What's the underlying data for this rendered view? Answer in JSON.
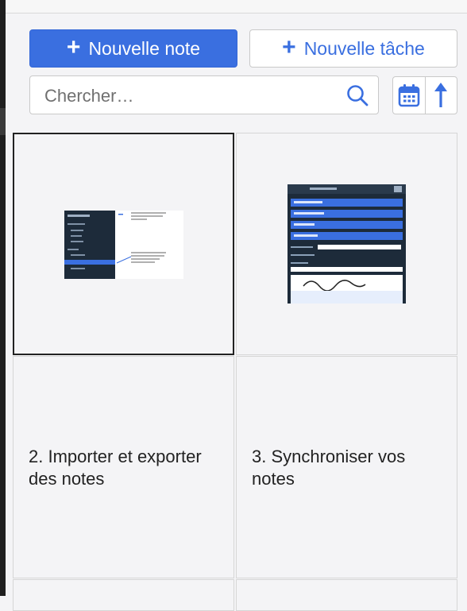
{
  "toolbar": {
    "new_note_label": "Nouvelle note",
    "new_task_label": "Nouvelle tâche",
    "search_placeholder": "Chercher…"
  },
  "icons": {
    "plus": "plus-icon",
    "search": "search-icon",
    "calendar": "calendar-icon",
    "sort": "arrow-up-icon"
  },
  "colors": {
    "accent": "#3a6fe0",
    "background": "#f4f4f6"
  },
  "notes": [
    {
      "title": "",
      "has_thumbnail": true,
      "selected": true
    },
    {
      "title": "",
      "has_thumbnail": true,
      "selected": false
    },
    {
      "title": "2. Importer et exporter des notes",
      "has_thumbnail": false,
      "selected": false
    },
    {
      "title": "3. Synchroniser vos notes",
      "has_thumbnail": false,
      "selected": false
    }
  ]
}
